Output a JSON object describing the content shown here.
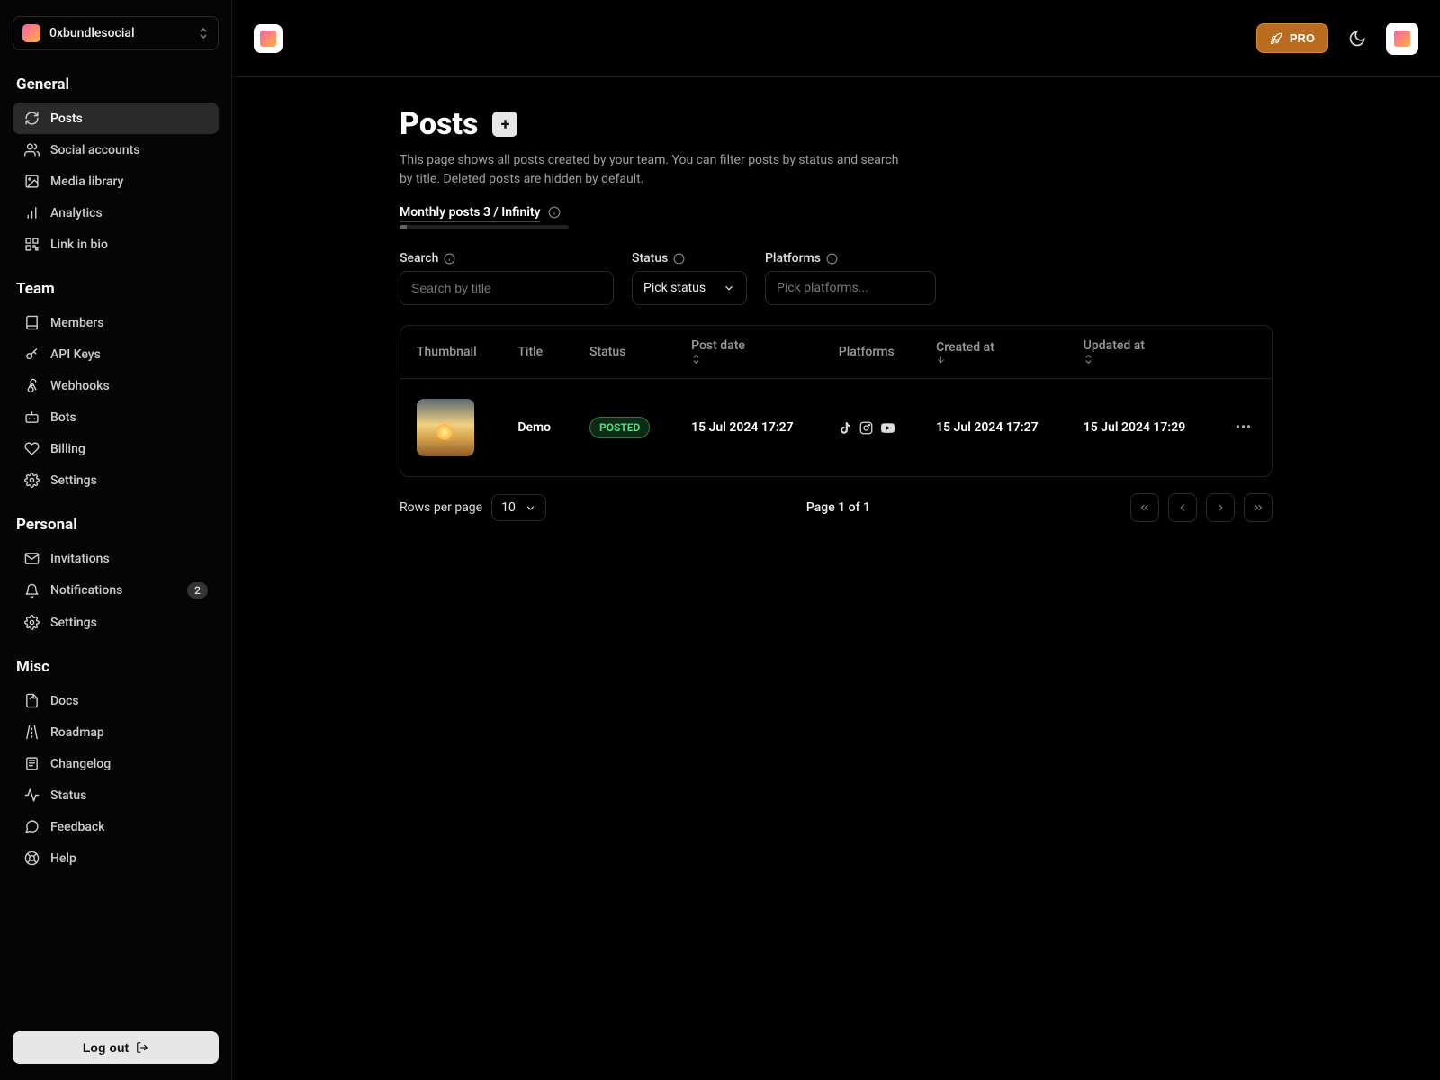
{
  "workspace": {
    "name": "0xbundlesocial"
  },
  "sidebar": {
    "sections": [
      {
        "title": "General",
        "items": [
          {
            "label": "Posts",
            "icon": "refresh",
            "active": true
          },
          {
            "label": "Social accounts",
            "icon": "users"
          },
          {
            "label": "Media library",
            "icon": "image"
          },
          {
            "label": "Analytics",
            "icon": "bar-chart"
          },
          {
            "label": "Link in bio",
            "icon": "qr"
          }
        ]
      },
      {
        "title": "Team",
        "items": [
          {
            "label": "Members",
            "icon": "book"
          },
          {
            "label": "API Keys",
            "icon": "key"
          },
          {
            "label": "Webhooks",
            "icon": "webhook"
          },
          {
            "label": "Bots",
            "icon": "bot"
          },
          {
            "label": "Billing",
            "icon": "heart"
          },
          {
            "label": "Settings",
            "icon": "gear"
          }
        ]
      },
      {
        "title": "Personal",
        "items": [
          {
            "label": "Invitations",
            "icon": "mail"
          },
          {
            "label": "Notifications",
            "icon": "bell",
            "badge": "2"
          },
          {
            "label": "Settings",
            "icon": "gear"
          }
        ]
      },
      {
        "title": "Misc",
        "items": [
          {
            "label": "Docs",
            "icon": "doc"
          },
          {
            "label": "Roadmap",
            "icon": "road"
          },
          {
            "label": "Changelog",
            "icon": "changelog"
          },
          {
            "label": "Status",
            "icon": "pulse"
          },
          {
            "label": "Feedback",
            "icon": "chat"
          },
          {
            "label": "Help",
            "icon": "life-ring"
          }
        ]
      }
    ],
    "logout": "Log out"
  },
  "topbar": {
    "pro": "PRO"
  },
  "page": {
    "title": "Posts",
    "description": "This page shows all posts created by your team. You can filter posts by status and search by title. Deleted posts are hidden by default.",
    "usage_label": "Monthly posts 3 / Infinity"
  },
  "filters": {
    "search_label": "Search",
    "search_placeholder": "Search by title",
    "status_label": "Status",
    "status_placeholder": "Pick status",
    "platforms_label": "Platforms",
    "platforms_placeholder": "Pick platforms..."
  },
  "table": {
    "columns": {
      "thumbnail": "Thumbnail",
      "title": "Title",
      "status": "Status",
      "post_date": "Post date",
      "platforms": "Platforms",
      "created_at": "Created at",
      "updated_at": "Updated at"
    },
    "rows": [
      {
        "title": "Demo",
        "status": "POSTED",
        "post_date": "15 Jul 2024 17:27",
        "platforms": [
          "tiktok",
          "instagram",
          "youtube"
        ],
        "created_at": "15 Jul 2024 17:27",
        "updated_at": "15 Jul 2024 17:29"
      }
    ]
  },
  "pagination": {
    "rows_per_page_label": "Rows per page",
    "rows_per_page_value": "10",
    "page_label": "Page 1 of 1"
  }
}
